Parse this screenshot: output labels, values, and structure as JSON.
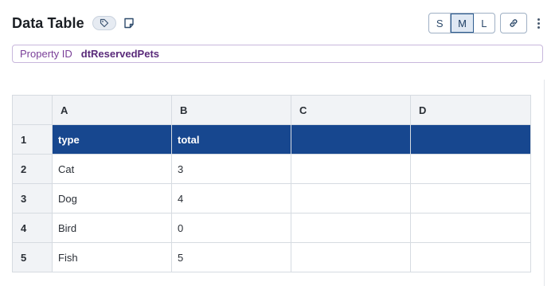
{
  "header": {
    "title": "Data Table",
    "tag_icon": "tag-icon",
    "note_icon": "note-icon"
  },
  "size_toggle": {
    "options": [
      "S",
      "M",
      "L"
    ],
    "selected": "M"
  },
  "toolbar": {
    "link_icon": "link-icon",
    "more_icon": "more-vertical-icon"
  },
  "property": {
    "label": "Property ID",
    "value": "dtReservedPets"
  },
  "table": {
    "column_headers": [
      "A",
      "B",
      "C",
      "D"
    ],
    "row_numbers": [
      "1",
      "2",
      "3",
      "4",
      "5"
    ],
    "rows": [
      [
        "type",
        "total",
        "",
        ""
      ],
      [
        "Cat",
        "3",
        "",
        ""
      ],
      [
        "Dog",
        "4",
        "",
        ""
      ],
      [
        "Bird",
        "0",
        "",
        ""
      ],
      [
        "Fish",
        "5",
        "",
        ""
      ]
    ]
  },
  "colors": {
    "header_row_bg": "#17478f",
    "property_border": "#c8b7dc",
    "property_text": "#7a3f98"
  }
}
